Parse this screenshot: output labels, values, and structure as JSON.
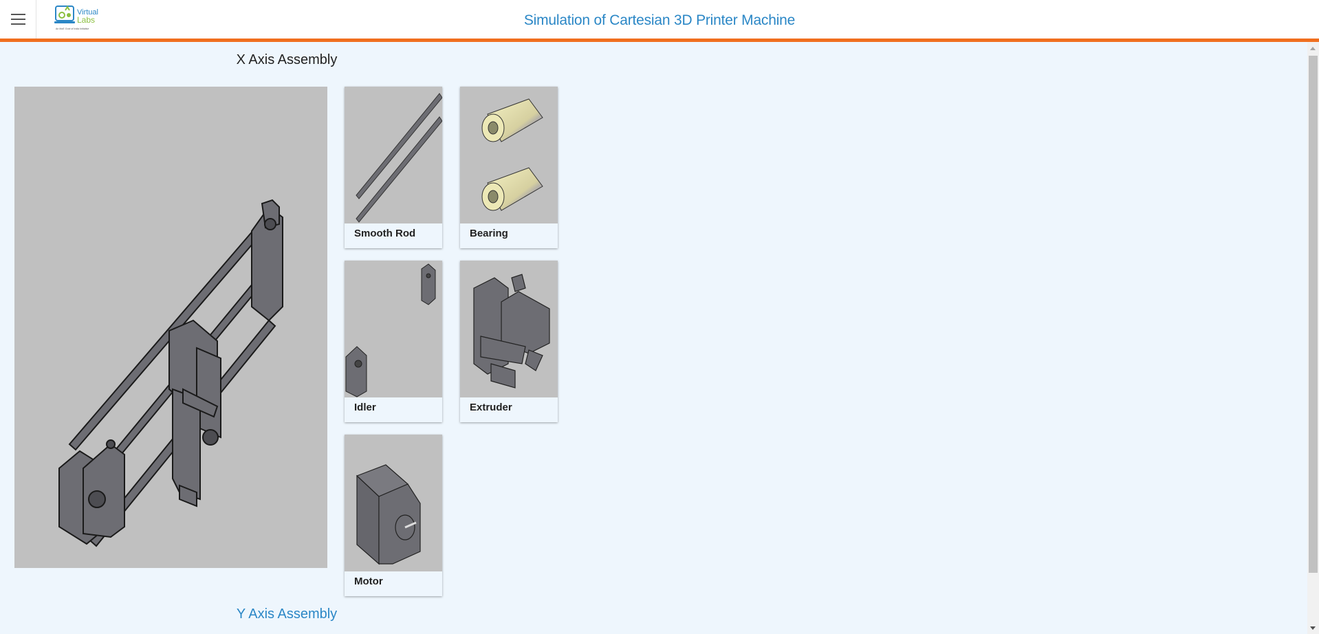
{
  "header": {
    "title": "Simulation of Cartesian 3D Printer Machine",
    "logo_text": "Virtual Labs",
    "logo_tagline": "An MoE Govt of India Initiative"
  },
  "sections": {
    "x_axis_title": "X Axis Assembly",
    "y_axis_title": "Y Axis Assembly"
  },
  "parts": [
    {
      "label": "Smooth Rod",
      "icon": "smooth-rod"
    },
    {
      "label": "Bearing",
      "icon": "bearing"
    },
    {
      "label": "Idler",
      "icon": "idler"
    },
    {
      "label": "Extruder",
      "icon": "extruder"
    },
    {
      "label": "Motor",
      "icon": "motor"
    }
  ],
  "colors": {
    "accent_orange": "#f06f1f",
    "title_blue": "#2b87c6",
    "background": "#eef6fd",
    "part_gray": "#c0c0c0"
  }
}
